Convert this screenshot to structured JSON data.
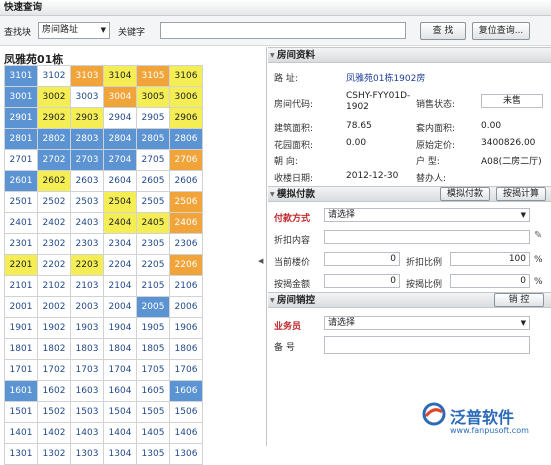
{
  "header": {
    "title": "快速查询"
  },
  "search": {
    "scope_label": "查找块",
    "scope_value": "房间路址",
    "keyword_label": "关键字",
    "keyword_value": "",
    "search_button": "查 找",
    "adv_button": "复位查询..."
  },
  "building": {
    "title": "凤雅苑01栋",
    "rows": [
      [
        [
          "3101",
          "blue"
        ],
        [
          "3102",
          "white"
        ],
        [
          "3103",
          "orange"
        ],
        [
          "3104",
          "yellow"
        ],
        [
          "3105",
          "orange"
        ],
        [
          "3106",
          "yellow"
        ]
      ],
      [
        [
          "3001",
          "blue"
        ],
        [
          "3002",
          "yellow"
        ],
        [
          "3003",
          "white"
        ],
        [
          "3004",
          "orange"
        ],
        [
          "3005",
          "yellow"
        ],
        [
          "3006",
          "yellow"
        ]
      ],
      [
        [
          "2901",
          "blue"
        ],
        [
          "2902",
          "yellow"
        ],
        [
          "2903",
          "yellow"
        ],
        [
          "2904",
          "white"
        ],
        [
          "2905",
          "white"
        ],
        [
          "2906",
          "yellow"
        ]
      ],
      [
        [
          "2801",
          "blue"
        ],
        [
          "2802",
          "blue"
        ],
        [
          "2803",
          "blue"
        ],
        [
          "2804",
          "blue"
        ],
        [
          "2805",
          "blue"
        ],
        [
          "2806",
          "blue"
        ]
      ],
      [
        [
          "2701",
          "white"
        ],
        [
          "2702",
          "blue"
        ],
        [
          "2703",
          "blue"
        ],
        [
          "2704",
          "blue"
        ],
        [
          "2705",
          "white"
        ],
        [
          "2706",
          "orange"
        ]
      ],
      [
        [
          "2601",
          "blue"
        ],
        [
          "2602",
          "yellow"
        ],
        [
          "2603",
          "white"
        ],
        [
          "2604",
          "white"
        ],
        [
          "2605",
          "white"
        ],
        [
          "2606",
          "white"
        ]
      ],
      [
        [
          "2501",
          "white"
        ],
        [
          "2502",
          "white"
        ],
        [
          "2503",
          "white"
        ],
        [
          "2504",
          "yellow"
        ],
        [
          "2505",
          "white"
        ],
        [
          "2506",
          "orange"
        ]
      ],
      [
        [
          "2401",
          "white"
        ],
        [
          "2402",
          "white"
        ],
        [
          "2403",
          "white"
        ],
        [
          "2404",
          "yellow"
        ],
        [
          "2405",
          "yellow"
        ],
        [
          "2406",
          "orange"
        ]
      ],
      [
        [
          "2301",
          "white"
        ],
        [
          "2302",
          "white"
        ],
        [
          "2303",
          "white"
        ],
        [
          "2304",
          "white"
        ],
        [
          "2305",
          "white"
        ],
        [
          "2306",
          "white"
        ]
      ],
      [
        [
          "2201",
          "yellow"
        ],
        [
          "2202",
          "white"
        ],
        [
          "2203",
          "yellow"
        ],
        [
          "2204",
          "white"
        ],
        [
          "2205",
          "white"
        ],
        [
          "2206",
          "orange"
        ]
      ],
      [
        [
          "2101",
          "white"
        ],
        [
          "2102",
          "white"
        ],
        [
          "2103",
          "white"
        ],
        [
          "2104",
          "white"
        ],
        [
          "2105",
          "white"
        ],
        [
          "2106",
          "white"
        ]
      ],
      [
        [
          "2001",
          "white"
        ],
        [
          "2002",
          "white"
        ],
        [
          "2003",
          "white"
        ],
        [
          "2004",
          "white"
        ],
        [
          "2005",
          "blue"
        ],
        [
          "2006",
          "white"
        ]
      ],
      [
        [
          "1901",
          "white"
        ],
        [
          "1902",
          "white"
        ],
        [
          "1903",
          "white"
        ],
        [
          "1904",
          "white"
        ],
        [
          "1905",
          "white"
        ],
        [
          "1906",
          "white"
        ]
      ],
      [
        [
          "1801",
          "white"
        ],
        [
          "1802",
          "white"
        ],
        [
          "1803",
          "white"
        ],
        [
          "1804",
          "white"
        ],
        [
          "1805",
          "white"
        ],
        [
          "1806",
          "white"
        ]
      ],
      [
        [
          "1701",
          "white"
        ],
        [
          "1702",
          "white"
        ],
        [
          "1703",
          "white"
        ],
        [
          "1704",
          "white"
        ],
        [
          "1705",
          "white"
        ],
        [
          "1706",
          "white"
        ]
      ],
      [
        [
          "1601",
          "blue"
        ],
        [
          "1602",
          "white"
        ],
        [
          "1603",
          "white"
        ],
        [
          "1604",
          "white"
        ],
        [
          "1605",
          "white"
        ],
        [
          "1606",
          "blue"
        ]
      ],
      [
        [
          "1501",
          "white"
        ],
        [
          "1502",
          "white"
        ],
        [
          "1503",
          "white"
        ],
        [
          "1504",
          "white"
        ],
        [
          "1505",
          "white"
        ],
        [
          "1506",
          "white"
        ]
      ],
      [
        [
          "1401",
          "white"
        ],
        [
          "1402",
          "white"
        ],
        [
          "1403",
          "white"
        ],
        [
          "1404",
          "white"
        ],
        [
          "1405",
          "white"
        ],
        [
          "1406",
          "white"
        ]
      ],
      [
        [
          "1301",
          "white"
        ],
        [
          "1302",
          "white"
        ],
        [
          "1303",
          "white"
        ],
        [
          "1304",
          "white"
        ],
        [
          "1305",
          "white"
        ],
        [
          "1306",
          "white"
        ]
      ]
    ]
  },
  "room_info": {
    "section_title": "房间资料",
    "address_label": "路 址:",
    "address_value": "凤雅苑01栋1902房",
    "code_label": "房间代码:",
    "code_value": "CSHY-FYY01D-1902",
    "sale_status_label": "销售状态:",
    "sale_status_value": "未售",
    "build_area_label": "建筑面积:",
    "build_area_value": "78.65",
    "inner_area_label": "套内面积:",
    "inner_area_value": "0.00",
    "garden_area_label": "花园面积:",
    "garden_area_value": "0.00",
    "orig_price_label": "原始定价:",
    "orig_price_value": "3400826.00",
    "orientation_label": "朝 向:",
    "orientation_value": "",
    "house_type_label": "户 型:",
    "house_type_value": "A08(二房二厅)",
    "delivery_label": "收楼日期:",
    "delivery_value": "2012-12-30",
    "handler_label": "替办人:",
    "handler_value": ""
  },
  "payment": {
    "section_title": "模拟付款",
    "simulate_button": "模拟付款",
    "calc_button": "按揭计算",
    "method_label": "付款方式",
    "method_value": "请选择",
    "discount_label": "折扣内容",
    "current_price_label": "当前楼价",
    "current_price_value": "0",
    "discount_ratio_label": "折扣比例",
    "discount_ratio_value": "100",
    "percent_sign": "%",
    "loan_amount_label": "按揭金额",
    "loan_amount_value": "0",
    "loan_ratio_label": "按揭比例",
    "loan_ratio_value": "0"
  },
  "control": {
    "section_title": "房间销控",
    "control_button": "销 控",
    "salesman_label": "业务员",
    "salesman_value": "请选择",
    "remark_label": "备 号"
  },
  "watermark": {
    "brand": "泛普软件",
    "url": "www.fanpusoft.com"
  },
  "colors": {
    "available": "#ffffff",
    "sold": "#5b93d3",
    "reserved": "#f0a43a",
    "pending": "#f4ee54"
  }
}
